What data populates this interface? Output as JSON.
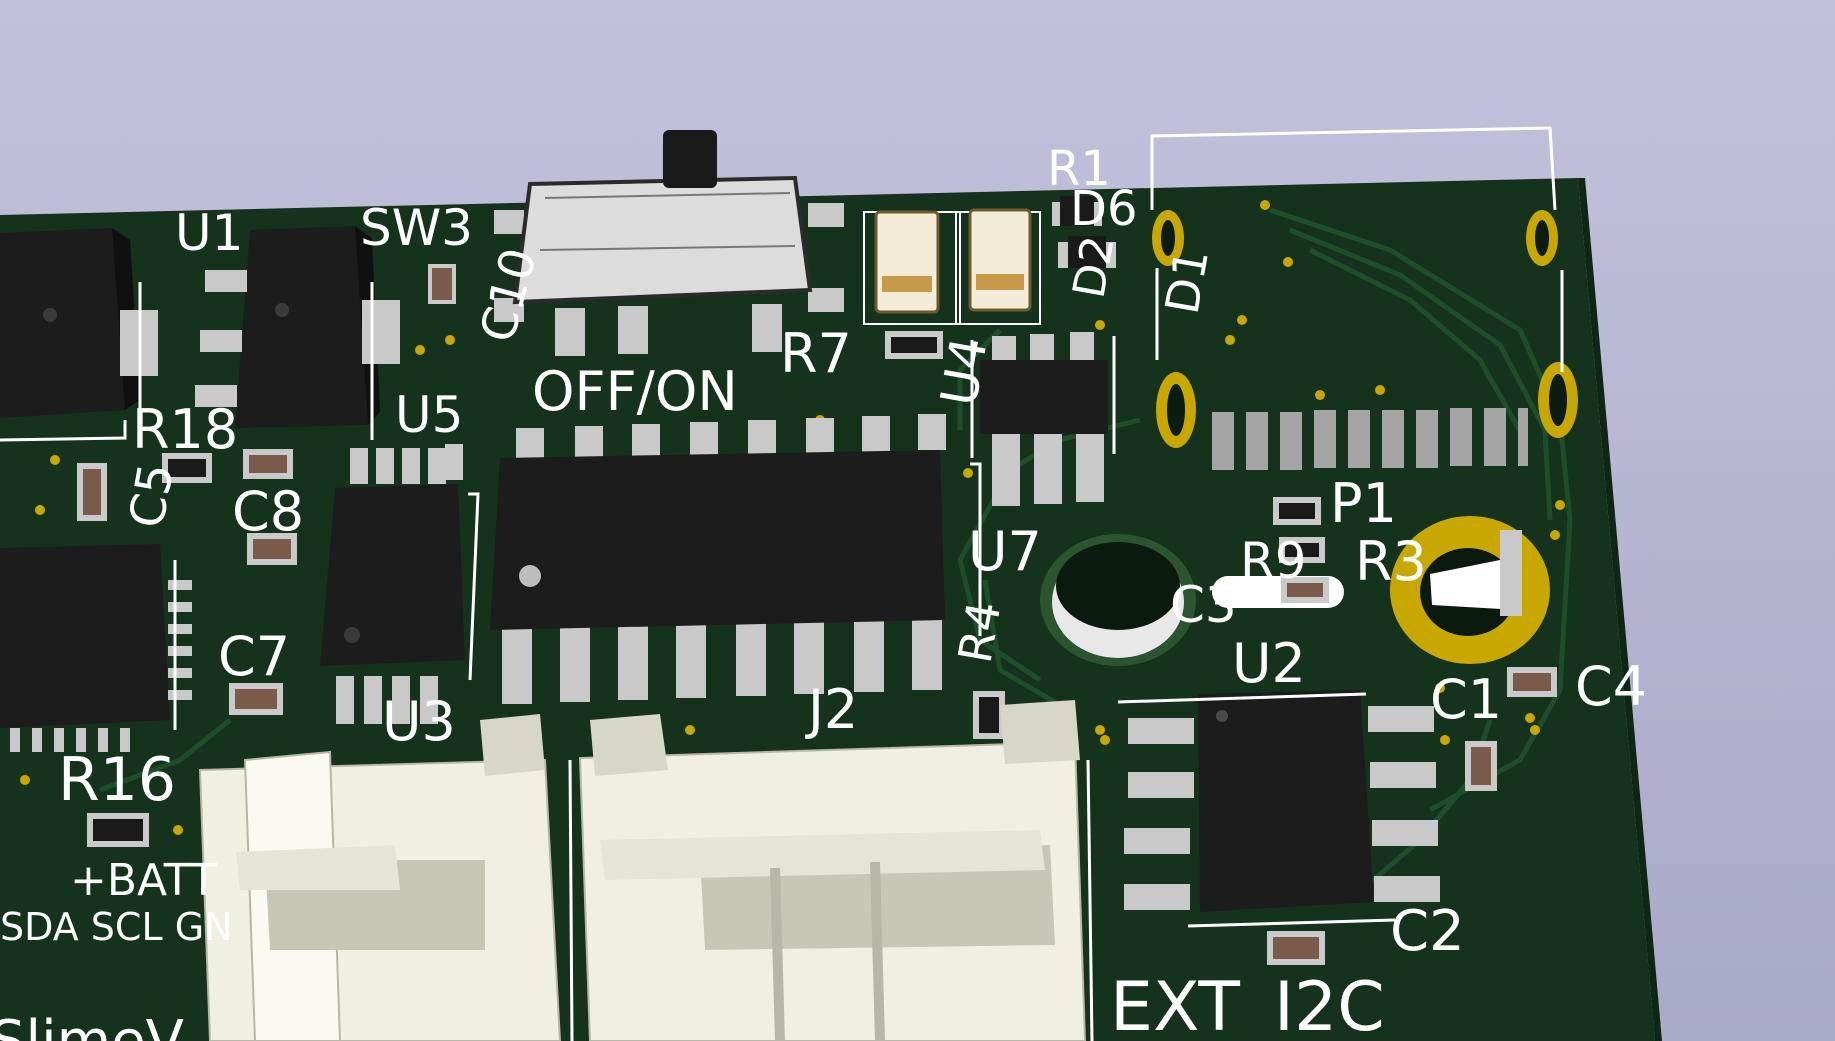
{
  "colors": {
    "background_top": "#c2c2dc",
    "background_bottom": "#a9a9c8",
    "board": "#14321c",
    "trace": "#1d4a29",
    "silkscreen": "#ffffff",
    "ic_body": "#1e1e1e",
    "pad_metal": "#c9c9c9",
    "gold": "#c8a800",
    "connector": "#efeee0"
  },
  "labels": {
    "u1": "U1",
    "sw3": "SW3",
    "c10": "C10",
    "off_on": "OFF/ON",
    "r7": "R7",
    "u4": "U4",
    "r1": "R1",
    "d6": "D6",
    "d2": "D2",
    "d1": "D1",
    "r18": "R18",
    "u5": "U5",
    "c5": "C5",
    "c8": "C8",
    "c7": "C7",
    "u3": "U3",
    "j2": "J2",
    "u7": "U7",
    "r4": "R4",
    "p1": "P1",
    "r9": "R9",
    "r3": "R3",
    "c3": "C3",
    "u2": "U2",
    "c1": "C1",
    "c4": "C4",
    "r16": "R16",
    "batt": "+BATT",
    "i2c_pins": "SDA SCL GN",
    "c2": "C2",
    "ext_i2c": "EXT_I2C",
    "slime": "SlimeV"
  }
}
